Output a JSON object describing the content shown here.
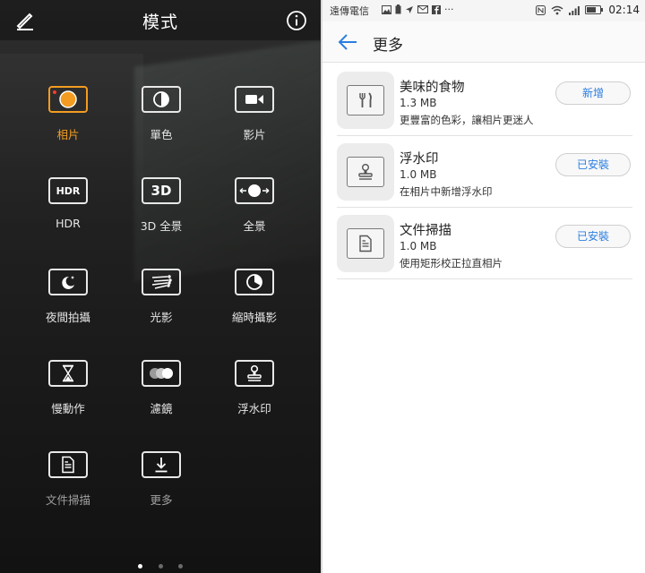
{
  "left": {
    "title": "模式",
    "modes": [
      {
        "label": "相片",
        "tile": "",
        "active": true
      },
      {
        "label": "單色",
        "tile": ""
      },
      {
        "label": "影片",
        "tile": ""
      },
      {
        "label": "HDR",
        "tile": "HDR"
      },
      {
        "label": "3D 全景",
        "tile": "3D"
      },
      {
        "label": "全景",
        "tile": ""
      },
      {
        "label": "夜間拍攝",
        "tile": ""
      },
      {
        "label": "光影",
        "tile": ""
      },
      {
        "label": "縮時攝影",
        "tile": ""
      },
      {
        "label": "慢動作",
        "tile": ""
      },
      {
        "label": "濾鏡",
        "tile": ""
      },
      {
        "label": "浮水印",
        "tile": ""
      },
      {
        "label": "文件掃描",
        "tile": ""
      },
      {
        "label": "更多",
        "tile": ""
      }
    ],
    "accent": "#f39c21"
  },
  "right": {
    "status": {
      "carrier": "遠傳電信",
      "more": "···",
      "time": "02:14"
    },
    "header": {
      "title": "更多"
    },
    "items": [
      {
        "name": "美味的食物",
        "size": "1.3 MB",
        "desc": "更豐富的色彩，讓相片更迷人",
        "button": "新增"
      },
      {
        "name": "浮水印",
        "size": "1.0 MB",
        "desc": "在相片中新增浮水印",
        "button": "已安裝"
      },
      {
        "name": "文件掃描",
        "size": "1.0 MB",
        "desc": "使用矩形校正拉直相片",
        "button": "已安裝"
      }
    ],
    "link_color": "#2a7de1"
  }
}
